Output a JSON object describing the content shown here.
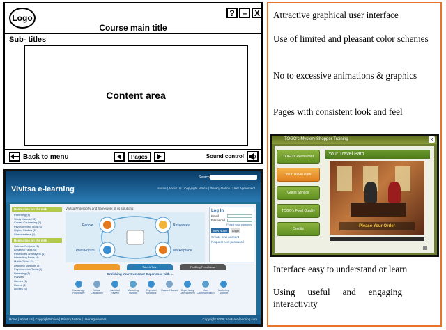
{
  "wireframe": {
    "logo": "Logo",
    "window_buttons": [
      "?",
      "–",
      "X"
    ],
    "course_title": "Course main title",
    "subtitles": "Sub- titles",
    "content_area": "Content area",
    "back_to_menu": "Back to menu",
    "pages_label": "Pages",
    "sound_control": "Sound control",
    "icons": {
      "back": "arrow-left-icon",
      "prev": "triangle-left-icon",
      "next": "triangle-right-icon",
      "sound": "speaker-icon"
    }
  },
  "right_panel": {
    "text_top": [
      "Attractive  graphical user interface",
      "Use of  limited  and pleasant color schemes",
      "No to  excessive animations & graphics",
      "Pages with  consistent look  and feel"
    ],
    "text_bottom": [
      "Interface easy to understand or learn",
      "Using  useful  and  engaging interactivity"
    ],
    "border_color": "#e8742b"
  },
  "vivitsa": {
    "brand": "Vivitsa e-learning",
    "search_label": "Search",
    "top_nav": "Home  |  About Us  |  Copyright Notice  |  Privacy Notice  |  User Agreement",
    "sidebar_head_1": "Resources on the web",
    "sidebar_list_1": [
      "Parenting (6)",
      "Study Material (3)",
      "Career Counseling (1)",
      "Psychometric Tools (1)",
      "Higher Studies (2)",
      "Stressbusters (1)"
    ],
    "sidebar_head_2": "Resources on the web",
    "sidebar_list_2": [
      "Science Projects (1)",
      "Amazing Facts (5)",
      "Paradoxes and Myths (1)",
      "Interesting Facts (4)",
      "Maths Tricks (1)",
      "Learning Methods (1)",
      "Psychometric Tools (6)",
      "Parenting (1)",
      "Puzzles",
      "Games (1)",
      "Humor (1)",
      "Quotes (6)"
    ],
    "center_title": "Vivitsa Philosophy and framework of its solutions:",
    "diagram_labels": {
      "people": "People",
      "resources": "Resources",
      "town_forum": "Town Forum",
      "marketplace": "Marketplace"
    },
    "login": {
      "heading": "Log In",
      "email": "Email",
      "password": "Password",
      "forgot": "Forgot your password",
      "join": "JOIN NOW!",
      "login_btn": "Login",
      "create": "Create new account",
      "request": "Request new password"
    },
    "promo_tabs": [
      "",
      "Take A Tour!",
      "Profiling From Ideas"
    ],
    "enrich": "Enriching Your Customer Experience with ...",
    "icon_labels": [
      "Knowledge Repository",
      "Virtual Classroom",
      "Assisted Review",
      "Marketing Support",
      "Expected Solutions",
      "Reward Based",
      "Opportunity Development",
      "User Communication",
      "Marketing Support"
    ],
    "footer_left": "Home  |  About Us  |  Copyright Notice  |  Privacy Notice  |  User Agreement",
    "footer_right": "Copyright 2008 : Vivitsa e-learning.com"
  },
  "training": {
    "title": "TOGO's Mystery Shopper Training",
    "panel_title": "Your Travel Path",
    "nav": [
      "TOGO's Restaurant",
      "Your Travel Path",
      "Guest Service",
      "TOGO's Food Quality",
      "Credits"
    ],
    "caption": "Please Your Order",
    "close": "x"
  }
}
